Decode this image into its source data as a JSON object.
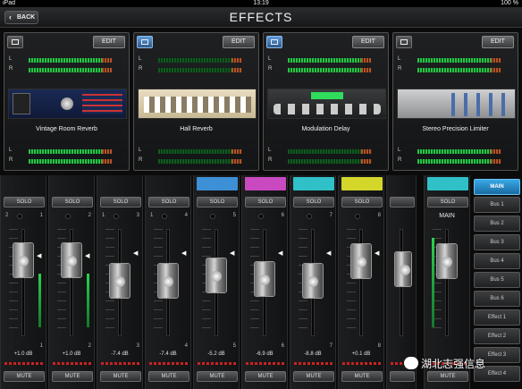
{
  "status_bar": {
    "carrier": "iPad",
    "time": "13:19",
    "battery": "100 %"
  },
  "header": {
    "back_label": "BACK",
    "title": "EFFECTS"
  },
  "effects": [
    {
      "name": "Vintage Room Reverb",
      "edit_label": "EDIT",
      "selected": false
    },
    {
      "name": "Hall Reverb",
      "edit_label": "EDIT",
      "selected": true
    },
    {
      "name": "Modulation Delay",
      "edit_label": "EDIT",
      "selected": true
    },
    {
      "name": "Stereo Precision Limiter",
      "edit_label": "EDIT",
      "selected": false
    }
  ],
  "meter_labels": {
    "left": "L",
    "right": "R"
  },
  "channels": [
    {
      "number": "1",
      "top_num": "1",
      "sel": "2",
      "color": "",
      "gain_db": "+1.0 dB",
      "solo_label": "SOLO",
      "mute_label": "MUTE"
    },
    {
      "number": "2",
      "top_num": "2",
      "sel": "",
      "color": "",
      "gain_db": "+1.0 dB",
      "solo_label": "SOLO",
      "mute_label": "MUTE"
    },
    {
      "number": "3",
      "top_num": "3",
      "sel": "1",
      "color": "",
      "gain_db": "-7.4 dB",
      "solo_label": "SOLO",
      "mute_label": "MUTE"
    },
    {
      "number": "4",
      "top_num": "4",
      "sel": "1",
      "color": "",
      "gain_db": "-7.4 dB",
      "solo_label": "SOLO",
      "mute_label": "MUTE"
    },
    {
      "number": "5",
      "top_num": "5",
      "sel": "",
      "color": "#3d8fd6",
      "gain_db": "-5.2 dB",
      "solo_label": "SOLO",
      "mute_label": "MUTE"
    },
    {
      "number": "6",
      "top_num": "6",
      "sel": "",
      "color": "#c949c0",
      "gain_db": "-6.9 dB",
      "solo_label": "SOLO",
      "mute_label": "MUTE"
    },
    {
      "number": "7",
      "top_num": "7",
      "sel": "",
      "color": "#2fc0c8",
      "gain_db": "-8.8 dB",
      "solo_label": "SOLO",
      "mute_label": "MUTE"
    },
    {
      "number": "8",
      "top_num": "8",
      "sel": "",
      "color": "#d4d62a",
      "gain_db": "+0.1 dB",
      "solo_label": "SOLO",
      "mute_label": "MUTE"
    }
  ],
  "main_strip": {
    "label": "MAIN",
    "color": "#2fc0c8",
    "solo_label": "SOLO",
    "mute_label": "MUTE"
  },
  "bus_list": [
    "MAIN",
    "Bus 1",
    "Bus 2",
    "Bus 3",
    "Bus 4",
    "Bus 5",
    "Bus 6",
    "Effect 1",
    "Effect 2",
    "Effect 3",
    "Effect 4"
  ],
  "watermark": "湖北志强信息"
}
